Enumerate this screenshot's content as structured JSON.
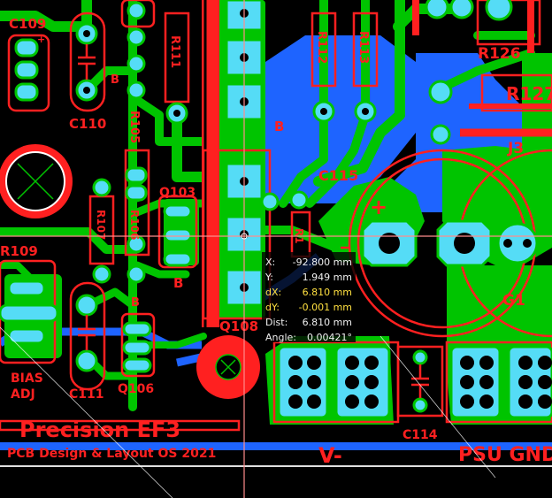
{
  "colors": {
    "background": "#000000",
    "copper_top": "#00c400",
    "copper_bottom": "#1e64ff",
    "pad": "#55dcf6",
    "silkscreen": "#ff2020",
    "crosshair": "#ff8c8c",
    "readout_highlight": "#ffe040"
  },
  "components": {
    "c109": "C109",
    "c110": "C110",
    "r111": "R111",
    "r112": "R112",
    "r113": "R113",
    "r126": "R126",
    "r127": "R127",
    "j3": "J3",
    "r105": "R105",
    "q103": "Q103",
    "r107": "R107",
    "r106": "R106",
    "c115": "C115",
    "r109": "R109",
    "q108": "Q108",
    "c111": "C111",
    "q106": "Q106",
    "c114": "C114",
    "g1": "G1",
    "b1": "B",
    "b2": "B",
    "b3": "B",
    "b4": "B",
    "plus": "+",
    "plus_small": "+",
    "bias_line1": "BIAS",
    "bias_line2": "ADJ",
    "r1_partial": "R1"
  },
  "board": {
    "title": "Precision EF3",
    "credit": "PCB Design & Layout OS 2021",
    "v_minus": "V-",
    "psu_gnd": "PSU GND"
  },
  "measurement": {
    "x_label": "X:",
    "x_value": "-92.800 mm",
    "y_label": "Y:",
    "y_value": "1.949 mm",
    "dx_label": "dX:",
    "dx_value": "6.810 mm",
    "dy_label": "dY:",
    "dy_value": "-0.001 mm",
    "dist_label": "Dist:",
    "dist_value": "6.810 mm",
    "angle_label": "Angle:",
    "angle_value": "0.00421°"
  }
}
